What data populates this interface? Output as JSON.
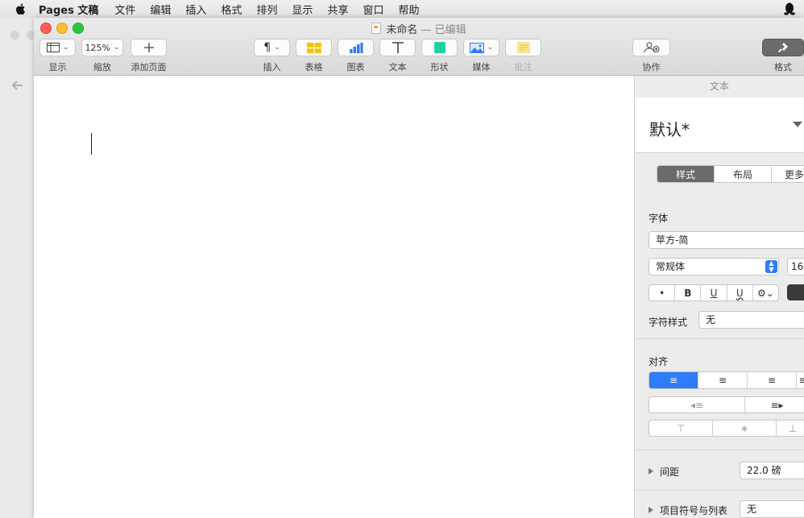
{
  "menubar": {
    "app": "Pages 文稿",
    "items": [
      "文件",
      "编辑",
      "插入",
      "格式",
      "排列",
      "显示",
      "共享",
      "窗口",
      "帮助"
    ]
  },
  "window": {
    "title": "未命名",
    "edited": "— 已编辑"
  },
  "toolbar": {
    "view_label": "显示",
    "zoom_value": "125%",
    "zoom_label": "缩放",
    "add_page_label": "添加页面",
    "insert_label": "插入",
    "table_label": "表格",
    "chart_label": "图表",
    "text_label": "文本",
    "shape_label": "形状",
    "media_label": "媒体",
    "comment_label": "批注",
    "collab_label": "协作",
    "format_label": "格式"
  },
  "inspector": {
    "header": "文本",
    "paragraph_style": "默认*",
    "tabs": [
      "样式",
      "布局",
      "更多"
    ],
    "font_section": "字体",
    "font_name": "苹方-简",
    "font_style": "常规体",
    "font_size": "16",
    "char_style_label": "字符样式",
    "char_style_value": "无",
    "align_section": "对齐",
    "spacing_label": "间距",
    "spacing_value": "22.0 磅",
    "bullets_label": "项目符号与列表",
    "bullets_value": "无"
  },
  "colors": {
    "accent_blue": "#2e7cf6",
    "segment_selected": "#6b6b6b",
    "close": "#fd5e57",
    "minimize": "#febc2e",
    "zoom": "#28c840"
  }
}
